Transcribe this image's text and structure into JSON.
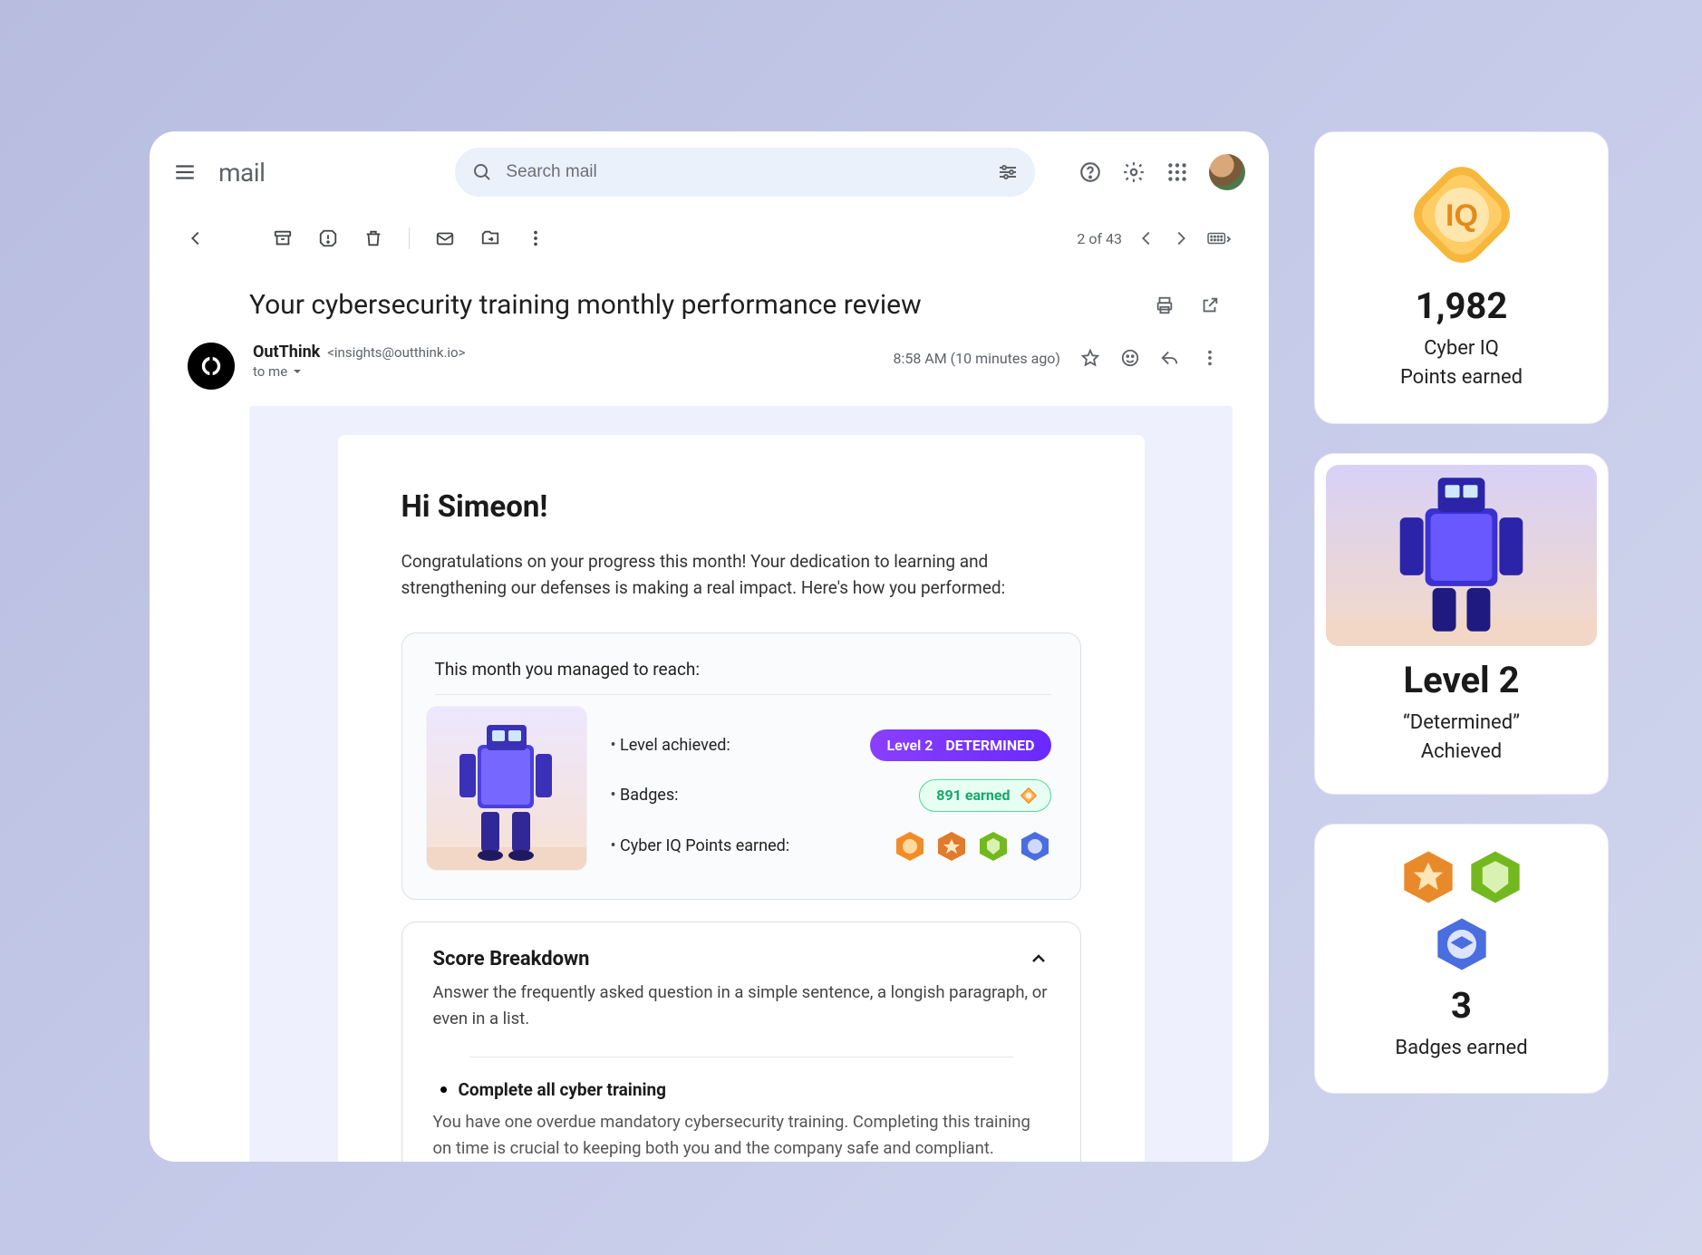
{
  "header": {
    "app_name": "mail",
    "search_placeholder": "Search mail"
  },
  "toolbar": {
    "counter": "2 of 43"
  },
  "email": {
    "subject": "Your cybersecurity training monthly performance review",
    "sender_name": "OutThink",
    "sender_email": "<insights@outthink.io>",
    "to_label": "to me",
    "timestamp": "8:58 AM (10 minutes ago)"
  },
  "body": {
    "greeting": "Hi Simeon!",
    "intro": "Congratulations on your progress this month! Your dedication to learning and strengthening our defenses is making a real impact. Here's how you performed:",
    "achievements": {
      "heading": "This month you managed to reach:",
      "level_label": "Level achieved:",
      "badges_label": "Badges:",
      "iq_label": "Cyber IQ Points earned:",
      "level_pill_level": "Level 2",
      "level_pill_title": "DETERMINED",
      "badges_pill": "891 earned"
    },
    "score": {
      "heading": "Score Breakdown",
      "desc": "Answer the frequently asked question in a simple sentence, a longish paragraph, or even in a list.",
      "item1_title": "Complete all cyber training",
      "item1_body": "You have one overdue mandatory cybersecurity training. Completing this training on time is crucial to keeping both you and the company safe and compliant."
    }
  },
  "side": {
    "iq_points": "1,982",
    "iq_line1": "Cyber IQ",
    "iq_line2": "Points earned",
    "level_title": "Level 2",
    "level_line1": "“Determined”",
    "level_line2": "Achieved",
    "badges_count": "3",
    "badges_label": "Badges earned"
  },
  "colors": {
    "purple": "#6929ff",
    "green": "#17a86a",
    "orange_hex": "#f28c28",
    "green_hex": "#74b820",
    "blue_hex": "#4a6de0",
    "lilac_bg": "#eef0fd"
  }
}
